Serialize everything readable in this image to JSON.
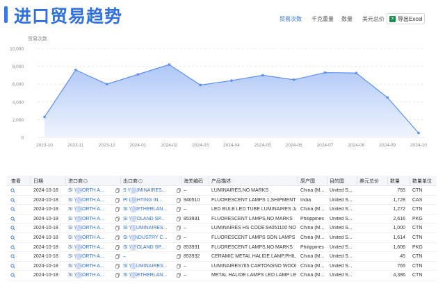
{
  "header": {
    "title": "进口贸易趋势",
    "metric_tabs": [
      "贸易次数",
      "千克重量",
      "数量",
      "美元总价"
    ],
    "active_metric": 0,
    "export_label": "导出Excel",
    "export_icon": "excel-icon"
  },
  "chart_data": {
    "type": "area",
    "ylabel": "贸易次数",
    "ylim": [
      0,
      10000
    ],
    "yticks": [
      "0",
      "2,000",
      "4,000",
      "6,000",
      "8,000",
      "10,000"
    ],
    "categories": [
      "2023-10",
      "2023-11",
      "2023-12",
      "2024-01",
      "2024-02",
      "2024-03",
      "2024-04",
      "2024-05",
      "2024-06",
      "2024-07",
      "2024-08",
      "2024-09",
      "2024-10"
    ],
    "values": [
      2300,
      7600,
      6000,
      7100,
      8200,
      5900,
      6400,
      7000,
      6500,
      7300,
      7250,
      4500,
      500
    ],
    "grid": true,
    "color": "#5b8ff9",
    "fill_top": "#a9c4f7",
    "fill_bottom": "#eef3fd"
  },
  "table": {
    "headers": [
      "查看",
      "日期",
      "进口商",
      "出口商",
      "海关编码",
      "产品描述",
      "原产国",
      "目的国",
      "美元总价",
      "数量",
      "数量单位"
    ],
    "rows": [
      [
        "2024-10-18",
        "SI   Y NORTH A...",
        "S   Y LUMINAIRES...",
        "–",
        "LUMINAIRES,NO MARKS",
        "China (M...",
        "United S...",
        "",
        "765",
        "CTN"
      ],
      [
        "2024-10-18",
        "SI   Y NORTH A...",
        "PI   LIGHTING IN...",
        "940510",
        "FLUORESCENT LAMPS 1,SHIPMENT REF...",
        "India",
        "United S...",
        "",
        "1,728",
        "CAS"
      ],
      [
        "2024-10-18",
        "SI   Y NORTH A...",
        "SI   Y NETHERLAN...",
        "–",
        "LED BULB LED TUBE LUMINAIRES JAN...",
        "China (M...",
        "United S...",
        "",
        "1,272",
        "CTN"
      ],
      [
        "2024-10-18",
        "SI   Y NORTH A...",
        "SI   Y POLAND SP...",
        "853931",
        "FLUORESCENT LAMPS,NO MARKS",
        "Philippines",
        "United S...",
        "",
        "2,616",
        "PKG"
      ],
      [
        "2024-10-18",
        "SI   Y NORTH A...",
        "SI   Y LUMINAIRES...",
        "–",
        "LUMINAIRES HS CODE:94051100 NO WO...",
        "China (M...",
        "United S...",
        "",
        "1,000",
        "CTN"
      ],
      [
        "2024-10-18",
        "SI   Y NORTH A...",
        "SI   Y INDUSTRY C...",
        "–",
        "FLUORESCENT LAMPS SON LAMPS UV ...",
        "China (M...",
        "United S...",
        "",
        "1,614",
        "CTN"
      ],
      [
        "2024-10-18",
        "SI   Y NORTH A...",
        "SI   Y POLAND SP...",
        "853931",
        "FLUORESCENT LAMPS,NO MARKS",
        "Philippines",
        "United S...",
        "",
        "1,606",
        "PKG"
      ],
      [
        "2024-10-18",
        "SI   Y NORTH A...",
        "–",
        "853932",
        "CERAMIC METAL HALIDE LAMP,PHILIPS",
        "China (M...",
        "United S...",
        "",
        "45",
        "CTN"
      ],
      [
        "2024-10-18",
        "SI   Y NORTH A...",
        "SI   Y LUMINAIRES...",
        "–",
        "LUMINAIRES765 CARTONSNO WOOD P...",
        "China (M...",
        "United S...",
        "",
        "765",
        "CTN"
      ],
      [
        "2024-10-18",
        "SI   Y NORTH A...",
        "SI   Y NETHERLAN...",
        "–",
        "METAL HALIDE LAMPS LED LAMP LED ...",
        "China (M...",
        "United S...",
        "",
        "4,386",
        "CTN"
      ]
    ]
  }
}
